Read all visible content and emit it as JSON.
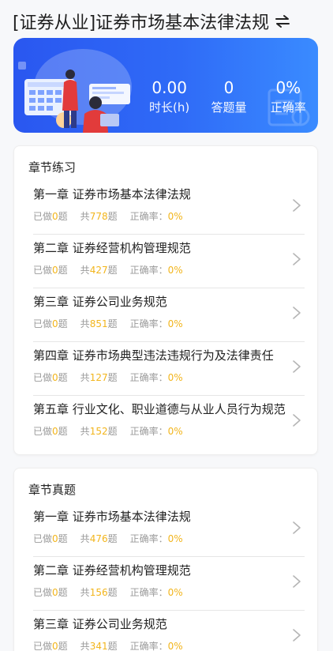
{
  "header": {
    "title": "[证券从业]证券市场基本法律法规",
    "switch_icon": "swap-arrows-icon"
  },
  "banner": {
    "colors": {
      "start": "#2a57f0",
      "end": "#3a8bff"
    },
    "stats": [
      {
        "value": "0.00",
        "label": "时长(h)"
      },
      {
        "value": "0",
        "label": "答题量"
      },
      {
        "value": "0%",
        "label": "正确率"
      }
    ]
  },
  "meta_labels": {
    "done_prefix": "已做",
    "done_suffix": "题",
    "total_prefix": "共",
    "total_suffix": "题",
    "accuracy_prefix": "正确率：",
    "highlight_color": "#f2b51c"
  },
  "practice": {
    "title": "章节练习",
    "items": [
      {
        "title": "第一章 证券市场基本法律法规",
        "done": "0",
        "total": "778",
        "accuracy": "0%"
      },
      {
        "title": "第二章 证券经营机构管理规范",
        "done": "0",
        "total": "427",
        "accuracy": "0%"
      },
      {
        "title": "第三章 证券公司业务规范",
        "done": "0",
        "total": "851",
        "accuracy": "0%"
      },
      {
        "title": "第四章 证券市场典型违法违规行为及法律责任",
        "done": "0",
        "total": "127",
        "accuracy": "0%"
      },
      {
        "title": "第五章 行业文化、职业道德与从业人员行为规范",
        "done": "0",
        "total": "152",
        "accuracy": "0%"
      }
    ]
  },
  "real_exams": {
    "title": "章节真题",
    "items": [
      {
        "title": "第一章 证券市场基本法律法规",
        "done": "0",
        "total": "476",
        "accuracy": "0%"
      },
      {
        "title": "第二章 证券经营机构管理规范",
        "done": "0",
        "total": "156",
        "accuracy": "0%"
      },
      {
        "title": "第三章 证券公司业务规范",
        "done": "0",
        "total": "341",
        "accuracy": "0%"
      }
    ]
  }
}
